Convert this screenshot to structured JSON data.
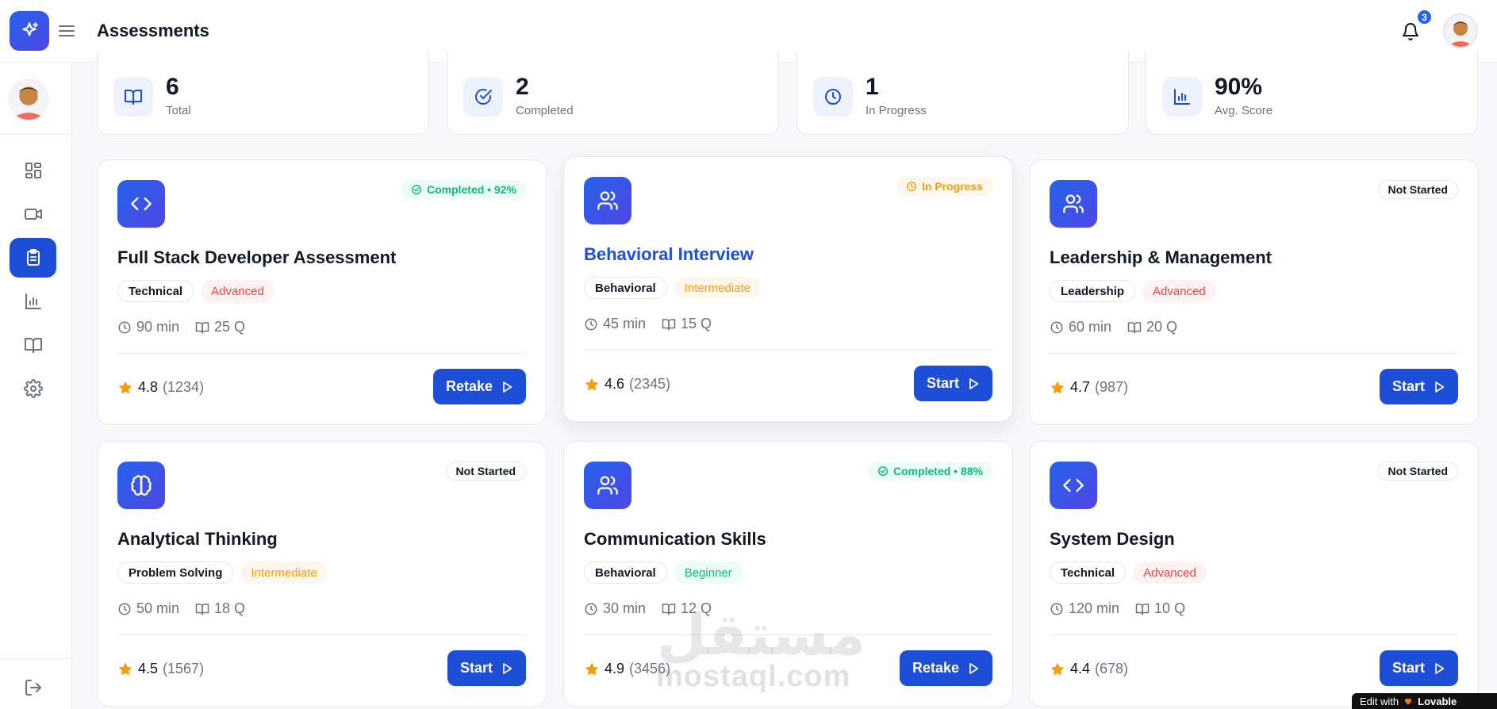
{
  "header": {
    "title": "Assessments",
    "notification_count": "3"
  },
  "stats": [
    {
      "value": "6",
      "label": "Total",
      "icon": "book-icon"
    },
    {
      "value": "2",
      "label": "Completed",
      "icon": "check-circle-icon"
    },
    {
      "value": "1",
      "label": "In Progress",
      "icon": "clock-icon"
    },
    {
      "value": "90%",
      "label": "Avg. Score",
      "icon": "bar-chart-icon"
    }
  ],
  "sidebar": {
    "items": [
      {
        "name": "dashboard",
        "icon": "grid-icon"
      },
      {
        "name": "interviews",
        "icon": "video-icon"
      },
      {
        "name": "assessments",
        "icon": "clipboard-icon",
        "active": true
      },
      {
        "name": "analytics",
        "icon": "bar-chart-icon"
      },
      {
        "name": "resources",
        "icon": "book-icon"
      },
      {
        "name": "settings",
        "icon": "gear-icon"
      }
    ],
    "logout_icon": "logout-icon"
  },
  "assessments": [
    {
      "title": "Full Stack Developer Assessment",
      "icon": "code-icon",
      "status": "Completed • 92%",
      "status_type": "completed",
      "category": "Technical",
      "level": "Advanced",
      "duration": "90 min",
      "questions": "25 Q",
      "rating": "4.8",
      "reviews": "(1234)",
      "action": "Retake"
    },
    {
      "title": "Behavioral Interview",
      "icon": "users-icon",
      "status": "In Progress",
      "status_type": "progress",
      "category": "Behavioral",
      "level": "Intermediate",
      "duration": "45 min",
      "questions": "15 Q",
      "rating": "4.6",
      "reviews": "(2345)",
      "action": "Start"
    },
    {
      "title": "Leadership & Management",
      "icon": "users-icon",
      "status": "Not Started",
      "status_type": "notstarted",
      "category": "Leadership",
      "level": "Advanced",
      "duration": "60 min",
      "questions": "20 Q",
      "rating": "4.7",
      "reviews": "(987)",
      "action": "Start"
    },
    {
      "title": "Analytical Thinking",
      "icon": "brain-icon",
      "status": "Not Started",
      "status_type": "notstarted",
      "category": "Problem Solving",
      "level": "Intermediate",
      "duration": "50 min",
      "questions": "18 Q",
      "rating": "4.5",
      "reviews": "(1567)",
      "action": "Start"
    },
    {
      "title": "Communication Skills",
      "icon": "users-icon",
      "status": "Completed • 88%",
      "status_type": "completed",
      "category": "Behavioral",
      "level": "Beginner",
      "duration": "30 min",
      "questions": "12 Q",
      "rating": "4.9",
      "reviews": "(3456)",
      "action": "Retake"
    },
    {
      "title": "System Design",
      "icon": "code-icon",
      "status": "Not Started",
      "status_type": "notstarted",
      "category": "Technical",
      "level": "Advanced",
      "duration": "120 min",
      "questions": "10 Q",
      "rating": "4.4",
      "reviews": "(678)",
      "action": "Start"
    }
  ],
  "watermark": {
    "arabic": "مستقل",
    "latin": "mostaql.com"
  },
  "lovable": {
    "prefix": "Edit with",
    "brand": "Lovable"
  },
  "colors": {
    "primary": "#1d4ed8",
    "success": "#10b981",
    "warning": "#f59e0b",
    "danger": "#ef4444"
  }
}
